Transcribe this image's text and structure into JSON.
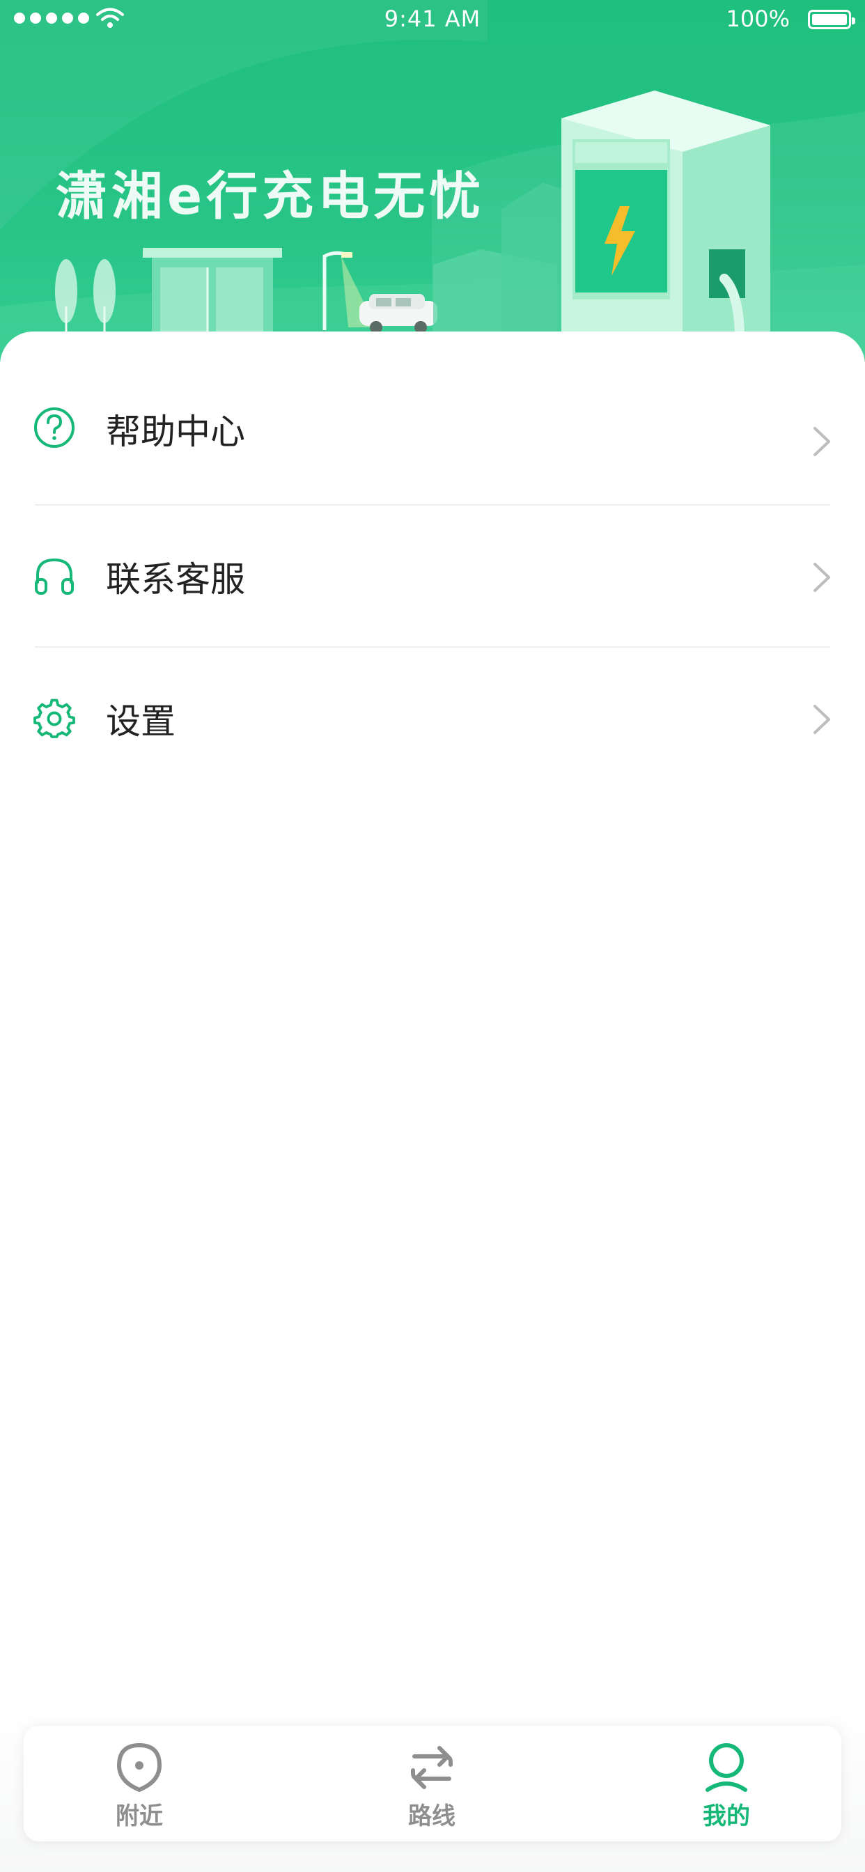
{
  "status_bar": {
    "time": "9:41 AM",
    "battery_percent": "100%",
    "battery_level": 1.0,
    "signal_icon": "signal-dots-icon",
    "wifi_icon": "wifi-icon"
  },
  "banner": {
    "slogan": "潇湘e行充电无忧",
    "illustration": "charging-station-illustration"
  },
  "menu": {
    "items": [
      {
        "label": "帮助中心",
        "icon": "help-circle-icon"
      },
      {
        "label": "联系客服",
        "icon": "headphones-icon"
      },
      {
        "label": "设置",
        "icon": "gear-icon"
      }
    ]
  },
  "tabbar": {
    "tabs": [
      {
        "label": "附近",
        "icon": "location-pin-icon",
        "active": false
      },
      {
        "label": "路线",
        "icon": "route-arrows-icon",
        "active": false
      },
      {
        "label": "我的",
        "icon": "user-icon",
        "active": true
      }
    ]
  },
  "colors": {
    "brand_green": "#1fbf7e",
    "active_tab": "#16b878",
    "inactive_tab": "#8e8e8e",
    "text_primary": "#222222",
    "divider": "#eeeeee"
  }
}
